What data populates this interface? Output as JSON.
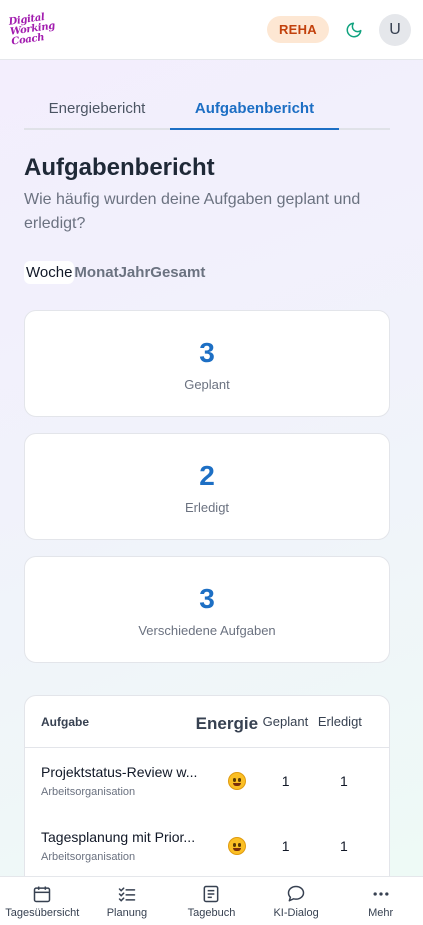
{
  "header": {
    "logo_lines": [
      "Digital",
      "Working",
      "Coach"
    ],
    "badge": "REHA",
    "avatar_initial": "U"
  },
  "report_tabs": [
    {
      "label": "Energiebericht",
      "active": false
    },
    {
      "label": "Aufgabenbericht",
      "active": true
    }
  ],
  "page": {
    "title": "Aufgabenbericht",
    "subtitle": "Wie häufig wurden deine Aufgaben geplant und erledigt?"
  },
  "period_tabs": [
    {
      "label": "Woche",
      "active": true
    },
    {
      "label": "Monat",
      "active": false
    },
    {
      "label": "Jahr",
      "active": false
    },
    {
      "label": "Gesamt",
      "active": false
    }
  ],
  "stats": [
    {
      "value": "3",
      "label": "Geplant"
    },
    {
      "value": "2",
      "label": "Erledigt"
    },
    {
      "value": "3",
      "label": "Verschiedene Aufgaben"
    }
  ],
  "table": {
    "headers": {
      "task": "Aufgabe",
      "energy": "Energie",
      "planned": "Geplant",
      "done": "Erledigt"
    },
    "rows": [
      {
        "task": "Projektstatus-Review w...",
        "category": "Arbeitsorganisation",
        "energy_icon": "grinning-face-icon",
        "planned": "1",
        "done": "1"
      },
      {
        "task": "Tagesplanung mit Prior...",
        "category": "Arbeitsorganisation",
        "energy_icon": "smiling-face-icon",
        "planned": "1",
        "done": "1"
      }
    ]
  },
  "bottom_nav": [
    {
      "label": "Tagesübersicht",
      "icon": "calendar-icon"
    },
    {
      "label": "Planung",
      "icon": "checklist-icon"
    },
    {
      "label": "Tagebuch",
      "icon": "journal-icon"
    },
    {
      "label": "KI-Dialog",
      "icon": "chat-icon"
    },
    {
      "label": "Mehr",
      "icon": "more-icon"
    }
  ],
  "colors": {
    "accent": "#1d6fc4",
    "badge_bg": "#fde7d3",
    "badge_text": "#c2410c",
    "logo": "#a21caf",
    "moon": "#10a37f"
  }
}
